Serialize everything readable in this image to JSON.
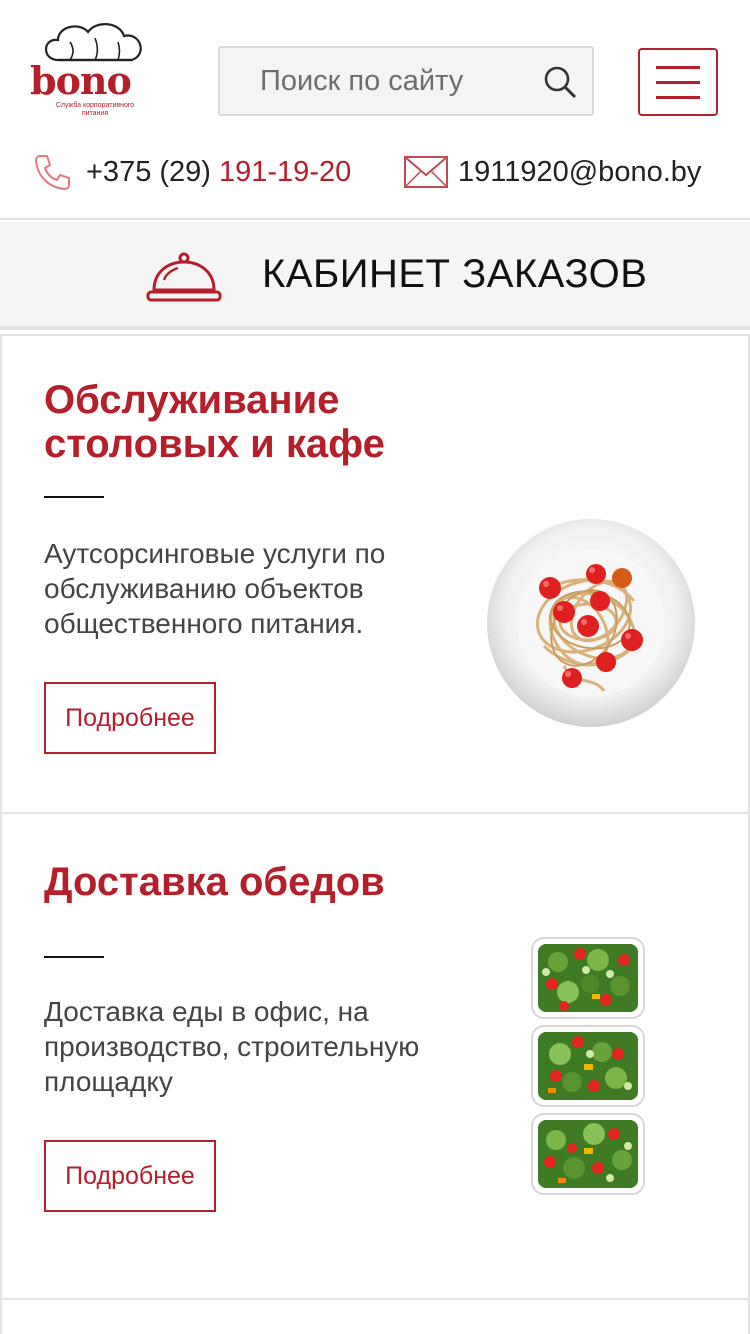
{
  "brand": {
    "logo_text": "bono",
    "logo_subtitle_line1": "Служба корпоративного",
    "logo_subtitle_line2": "питания",
    "accent_color": "#b51f2c"
  },
  "search": {
    "placeholder": "Поиск по сайту",
    "icon": "search-icon"
  },
  "menu": {
    "icon": "hamburger-icon"
  },
  "contacts": {
    "phone_prefix": "+375 (29) ",
    "phone_number": "191-19-20",
    "phone_icon": "phone-icon",
    "email": "1911920@bono.by",
    "email_icon": "envelope-icon"
  },
  "cabinet": {
    "icon": "cloche-icon",
    "title": "КАБИНЕТ ЗАКАЗОВ"
  },
  "services": [
    {
      "title": "Обслуживание столовых и кафе",
      "description": "Аутсорсинговые услуги по обслуживанию объектов общественного питания.",
      "button": "Подробнее",
      "image": "pasta-plate-image"
    },
    {
      "title": "Доставка обедов",
      "description": "Доставка еды в офис, на производство, строительную площадку",
      "button": "Подробнее",
      "image": "salad-containers-image"
    }
  ]
}
